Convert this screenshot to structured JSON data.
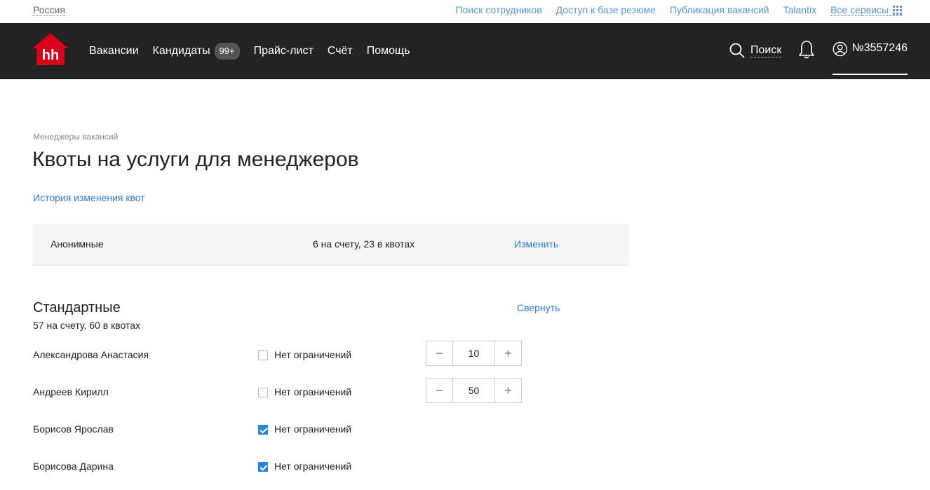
{
  "topbar": {
    "region": "Россия",
    "links": [
      "Поиск сотрудников",
      "Доступ к базе резюме",
      "Публикация вакансий",
      "Talantix"
    ],
    "all_services": "Все сервисы"
  },
  "header": {
    "logo_text": "hh",
    "nav": {
      "vacancies": "Вакансии",
      "candidates": "Кандидаты",
      "candidates_badge": "99+",
      "pricelist": "Прайс-лист",
      "invoice": "Счёт",
      "help": "Помощь"
    },
    "search_label": "Поиск",
    "account_number": "№3557246"
  },
  "page": {
    "breadcrumb": "Менеджеры вакансий",
    "title": "Квоты на услуги для менеджеров",
    "history_link": "История изменения квот"
  },
  "anonymous": {
    "name": "Анонимные",
    "count": "6 на счету, 23 в квотах",
    "edit_label": "Изменить"
  },
  "standard": {
    "title": "Стандартные",
    "subtitle": "57 на счету, 60 в квотах",
    "collapse_label": "Свернуть",
    "managers": [
      {
        "name": "Александрова Анастасия",
        "unlimited_label": "Нет ограничений",
        "unlimited": false,
        "quota": "10"
      },
      {
        "name": "Андреев Кирилл",
        "unlimited_label": "Нет ограничений",
        "unlimited": false,
        "quota": "50"
      },
      {
        "name": "Борисов Ярослав",
        "unlimited_label": "Нет ограничений",
        "unlimited": true
      },
      {
        "name": "Борисова Дарина",
        "unlimited_label": "Нет ограничений",
        "unlimited": true
      }
    ]
  },
  "colors": {
    "header_bg": "#232323",
    "link": "#2b7bd1",
    "logo_red": "#d6001c",
    "checkbox_on": "#2b86d9"
  }
}
